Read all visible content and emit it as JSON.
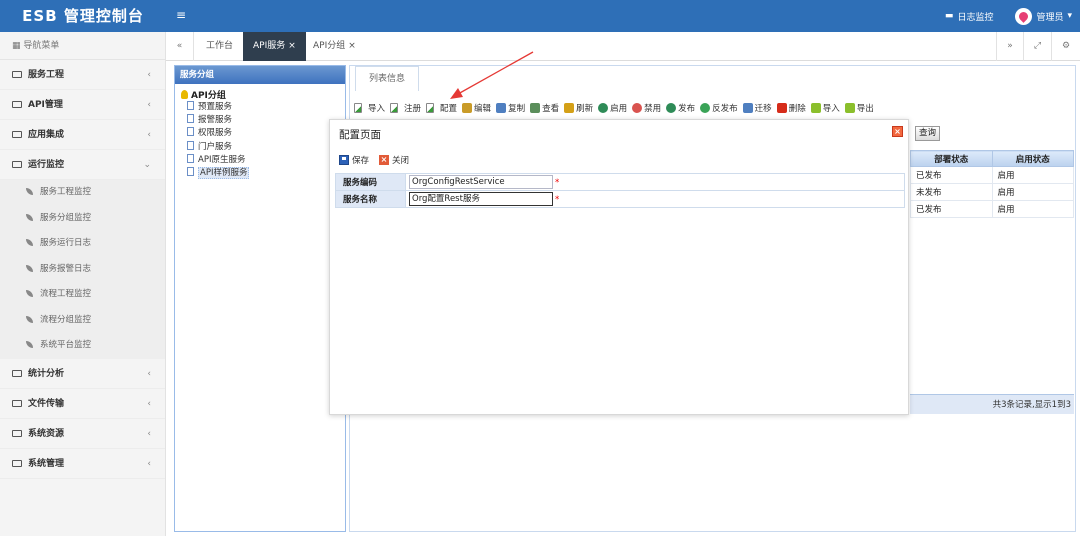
{
  "header": {
    "brand": "ESB 管理控制台",
    "menu_toggle_icon": "hamburger-icon",
    "log_monitor": "日志监控",
    "user": "管理员",
    "colors": {
      "header_bg": "#2e6fb7",
      "avatar_accent": "#e63f74"
    }
  },
  "sidebar": {
    "title": "导航菜单",
    "groups": [
      {
        "label": "服务工程",
        "chevron": "‹"
      },
      {
        "label": "API管理",
        "chevron": "‹"
      },
      {
        "label": "应用集成",
        "chevron": "‹"
      },
      {
        "label": "运行监控",
        "chevron": "⌄",
        "expanded": true,
        "items": [
          "服务工程监控",
          "服务分组监控",
          "服务运行日志",
          "服务报警日志",
          "流程工程监控",
          "流程分组监控",
          "系统平台监控"
        ]
      },
      {
        "label": "统计分析",
        "chevron": "‹"
      },
      {
        "label": "文件传输",
        "chevron": "‹"
      },
      {
        "label": "系统资源",
        "chevron": "‹"
      },
      {
        "label": "系统管理",
        "chevron": "‹"
      }
    ]
  },
  "tabs": {
    "items": [
      {
        "label": "工作台"
      },
      {
        "label": "API服务",
        "active": true,
        "close": "×"
      },
      {
        "label": "API分组",
        "close": "×"
      }
    ]
  },
  "tree": {
    "title": "服务分组",
    "root": "API分组",
    "nodes": [
      "预置服务",
      "报警服务",
      "权限服务",
      "门户服务",
      "API原生服务",
      "API样例服务"
    ],
    "selected_index": 5
  },
  "main": {
    "list_tab": "列表信息",
    "toolbar": [
      {
        "label": "导入",
        "icon": "import-icon",
        "color": "#3a9b3a"
      },
      {
        "label": "注册",
        "icon": "register-icon",
        "color": "#3a9b3a"
      },
      {
        "label": "配置",
        "icon": "config-icon",
        "color": "#3a9b3a"
      },
      {
        "label": "编辑",
        "icon": "edit-icon",
        "color": "#c99b28"
      },
      {
        "label": "复制",
        "icon": "copy-icon",
        "color": "#4f7fc0"
      },
      {
        "label": "查看",
        "icon": "view-icon",
        "color": "#5b8e5b"
      },
      {
        "label": "刷新",
        "icon": "refresh-icon",
        "color": "#d4a017"
      },
      {
        "label": "启用",
        "icon": "enable-icon",
        "color": "#2e8b57"
      },
      {
        "label": "禁用",
        "icon": "disable-icon",
        "color": "#d9534f"
      },
      {
        "label": "发布",
        "icon": "publish-icon",
        "color": "#2e8b57"
      },
      {
        "label": "反发布",
        "icon": "unpublish-icon",
        "color": "#3aa357"
      },
      {
        "label": "迁移",
        "icon": "migrate-icon",
        "color": "#4f7fc0"
      },
      {
        "label": "删除",
        "icon": "delete-icon",
        "color": "#d62c1a"
      },
      {
        "label": "导入",
        "icon": "import-icon-2",
        "color": "#8bbf2c"
      },
      {
        "label": "导出",
        "icon": "export-icon",
        "color": "#8bbf2c"
      }
    ],
    "query_button": "查询",
    "columns": [
      "部署状态",
      "启用状态"
    ],
    "rows": [
      [
        "已发布",
        "启用"
      ],
      [
        "未发布",
        "启用"
      ],
      [
        "已发布",
        "启用"
      ]
    ],
    "pager": "共3条记录,显示1到3"
  },
  "modal": {
    "title": "配置页面",
    "save": "保存",
    "close": "关闭",
    "close_icon": "close-icon",
    "fields": [
      {
        "label": "服务编码",
        "value": "OrgConfigRestService",
        "required": "*"
      },
      {
        "label": "服务名称",
        "value": "Org配置Rest服务",
        "required": "*"
      }
    ]
  },
  "annotation": {
    "arrow_color": "#e53935"
  }
}
